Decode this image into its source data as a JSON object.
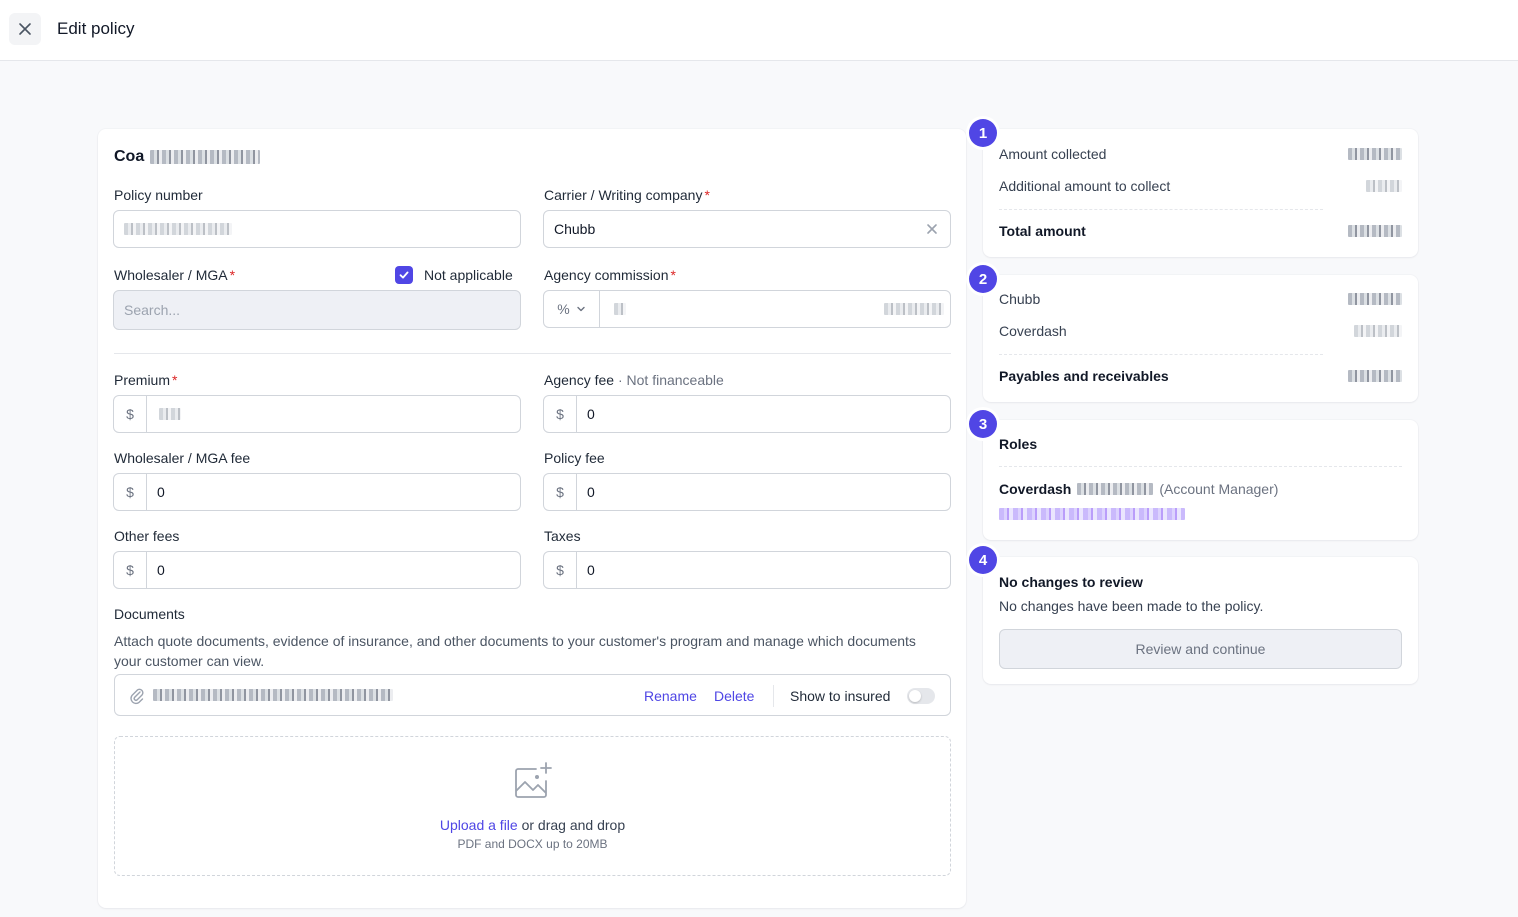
{
  "header": {
    "title": "Edit policy",
    "close_icon": "close-icon"
  },
  "form": {
    "insured_name_visible": "Coa",
    "policy_number": {
      "label": "Policy number",
      "value": ""
    },
    "carrier": {
      "label": "Carrier / Writing company",
      "required_mark": "*",
      "value": "Chubb"
    },
    "wholesaler": {
      "label": "Wholesaler / MGA",
      "required_mark": "*",
      "placeholder": "Search...",
      "not_applicable_label": "Not applicable",
      "not_applicable_checked": true
    },
    "agency_commission": {
      "label": "Agency commission",
      "required_mark": "*",
      "unit": "%"
    },
    "premium": {
      "label": "Premium",
      "required_mark": "*",
      "prefix": "$"
    },
    "agency_fee": {
      "label": "Agency fee",
      "separator": "·",
      "note": "Not financeable",
      "prefix": "$",
      "value": "0"
    },
    "wholesaler_fee": {
      "label": "Wholesaler / MGA fee",
      "prefix": "$",
      "value": "0"
    },
    "policy_fee": {
      "label": "Policy fee",
      "prefix": "$",
      "value": "0"
    },
    "other_fees": {
      "label": "Other fees",
      "prefix": "$",
      "value": "0"
    },
    "taxes": {
      "label": "Taxes",
      "prefix": "$",
      "value": "0"
    },
    "documents": {
      "label": "Documents",
      "description": "Attach quote documents, evidence of insurance, and other documents to your customer's program and manage which documents your customer can view.",
      "rename_label": "Rename",
      "delete_label": "Delete",
      "show_to_insured_label": "Show to insured",
      "show_to_insured": false,
      "upload_link": "Upload a file",
      "upload_rest": " or drag and drop",
      "upload_hint": "PDF and DOCX up to 20MB"
    }
  },
  "summary": {
    "step1": {
      "number": "1",
      "amount_collected": "Amount collected",
      "additional": "Additional amount to collect",
      "total": "Total amount"
    },
    "step2": {
      "number": "2",
      "carrier": "Chubb",
      "agency": "Coverdash",
      "total": "Payables and receivables"
    },
    "step3": {
      "number": "3",
      "title": "Roles",
      "agency": "Coverdash",
      "role": "(Account Manager)"
    },
    "step4": {
      "number": "4",
      "title": "No changes to review",
      "description": "No changes have been made to the policy.",
      "button": "Review and continue"
    }
  },
  "colors": {
    "accent": "#5046e5",
    "required": "#dc2626",
    "link": "#4f46e5"
  }
}
